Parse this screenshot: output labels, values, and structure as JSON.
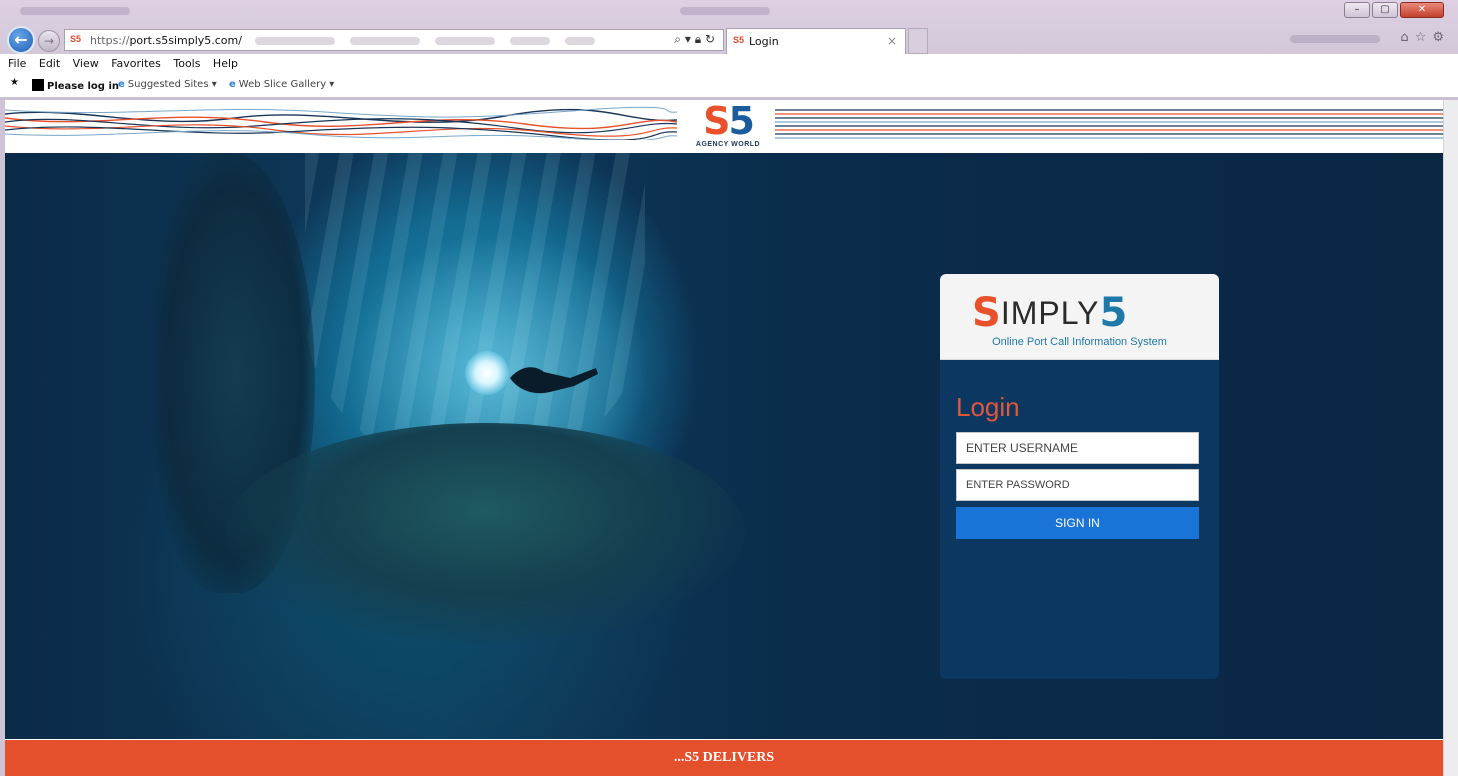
{
  "browser": {
    "address": {
      "protocol": "https://",
      "host": "port.s5simply5.com/",
      "favicon": "S5"
    },
    "tab": {
      "favicon": "S5",
      "title": "Login",
      "close": "×"
    },
    "menu": [
      "File",
      "Edit",
      "View",
      "Favorites",
      "Tools",
      "Help"
    ],
    "favorites": {
      "please_log_in": "Please log in",
      "suggested_sites": "Suggested Sites ▾",
      "web_slice_gallery": "Web Slice Gallery ▾"
    },
    "window_buttons": {
      "minimize": "–",
      "maximize": "▢",
      "close": "✕"
    }
  },
  "header": {
    "brand_mark_s": "S",
    "brand_mark_5": "5",
    "brand_sub": "AGENCY WORLD",
    "colors": {
      "orange": "#e9502c",
      "blue": "#1b5c9a"
    }
  },
  "login_card": {
    "logo": {
      "s": "S",
      "mid": "IMPLY",
      "five": "5"
    },
    "tagline": "Online Port Call Information System",
    "title": "Login",
    "username_placeholder": "ENTER USERNAME",
    "password_placeholder": "ENTER PASSWORD",
    "signin_label": "SIGN IN"
  },
  "footer": {
    "text": "...S5 DELIVERS"
  }
}
